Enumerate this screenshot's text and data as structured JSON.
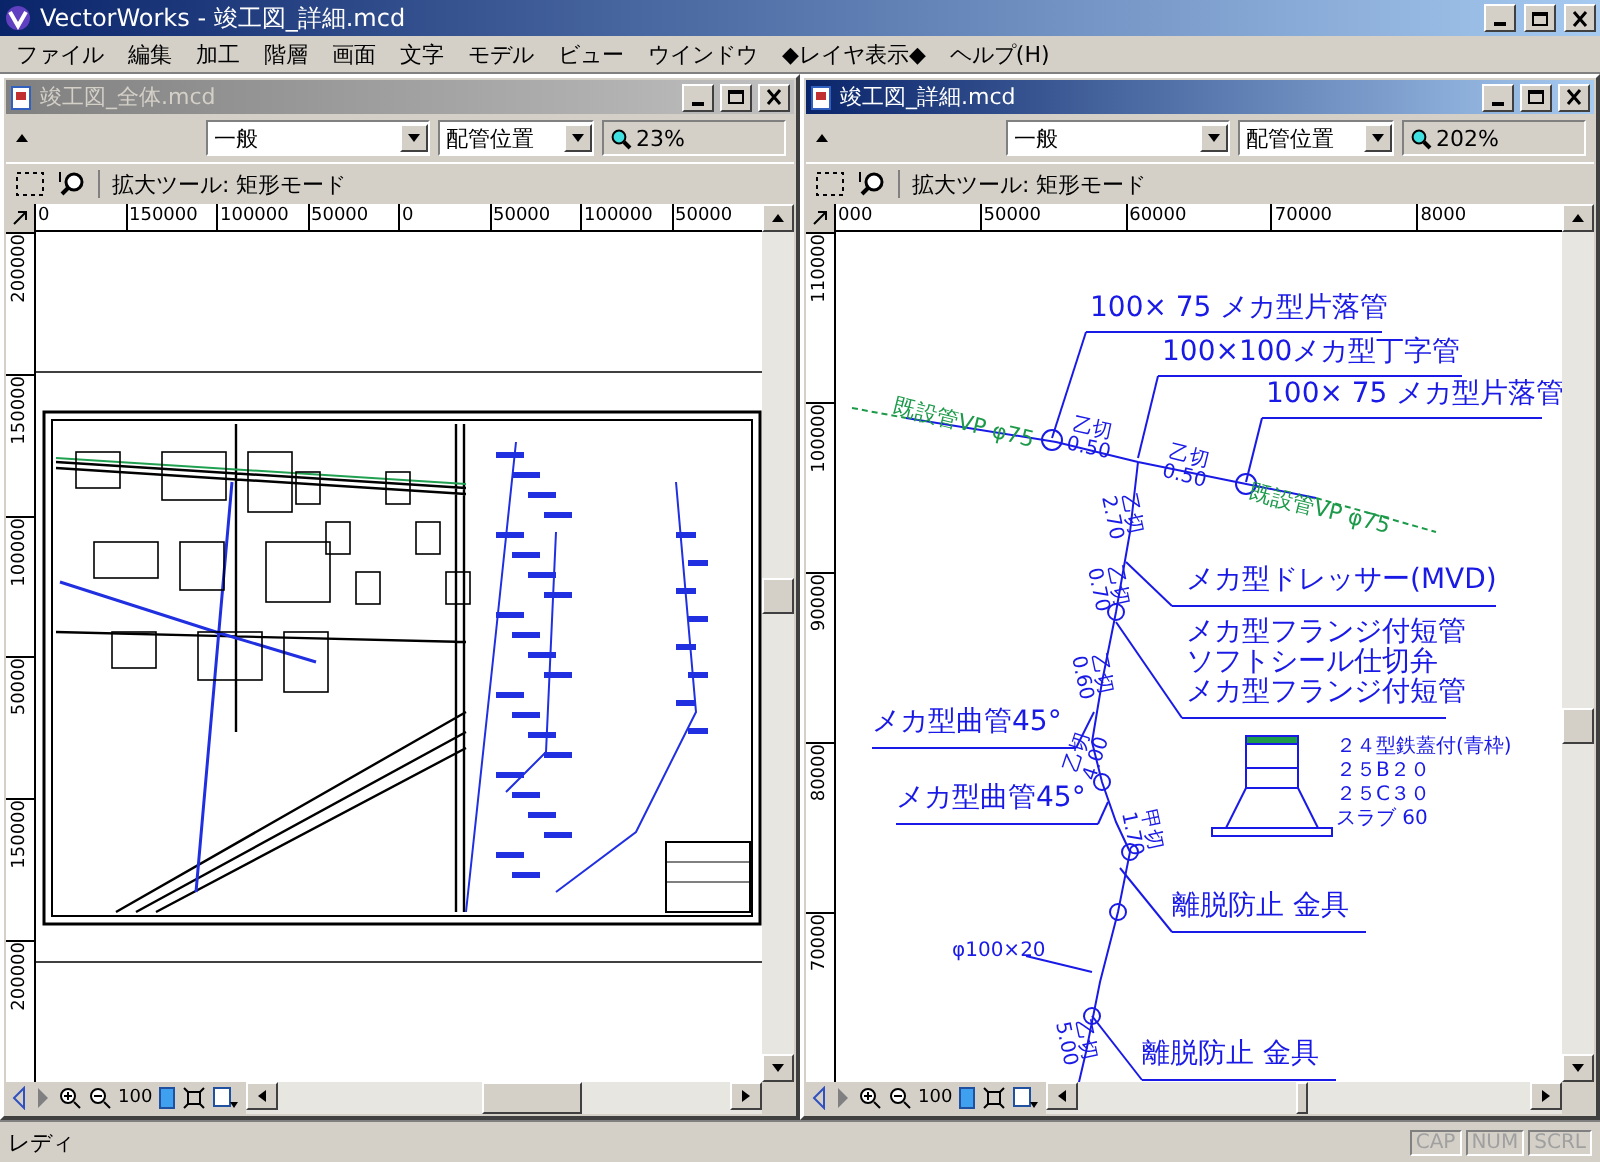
{
  "app_title": "VectorWorks - 竣工図_詳細.mcd",
  "menu": [
    "ファイル",
    "編集",
    "加工",
    "階層",
    "画面",
    "文字",
    "モデル",
    "ビュー",
    "ウインドウ",
    "◆レイヤ表示◆",
    "ヘルプ(H)"
  ],
  "windows": [
    {
      "title": "竣工図_全体.mcd",
      "active": false,
      "layer": "一般",
      "class": "配管位置",
      "zoom": "23%",
      "tool_hint": "拡大ツール: 矩形モード",
      "hruler": [
        "0",
        "150000",
        "100000",
        "50000",
        "0",
        "50000",
        "100000",
        "50000"
      ],
      "vruler": [
        "200000",
        "150000",
        "100000",
        "50000",
        "150000",
        "200000"
      ],
      "nav_scale": "100",
      "drawing": {
        "kind": "site_map"
      }
    },
    {
      "title": "竣工図_詳細.mcd",
      "active": true,
      "layer": "一般",
      "class": "配管位置",
      "zoom": "202%",
      "tool_hint": "拡大ツール: 矩形モード",
      "hruler": [
        "000",
        "50000",
        "60000",
        "70000",
        "8000"
      ],
      "vruler": [
        "110000",
        "100000",
        "90000",
        "80000",
        "70000"
      ],
      "nav_scale": "100",
      "drawing": {
        "kind": "pipe_detail",
        "callouts": [
          {
            "lines": [
              "100× 75 メカ型片落管"
            ]
          },
          {
            "lines": [
              "100×100メカ型丁字管"
            ]
          },
          {
            "lines": [
              "100× 75 メカ型片落管"
            ]
          },
          {
            "lines": [
              "メカ型ドレッサー(MVD)"
            ]
          },
          {
            "lines": [
              "メカ型フランジ付短管",
              "ソフトシール仕切弁",
              "メカ型フランジ付短管"
            ]
          },
          {
            "lines": [
              "メカ型曲管45°"
            ]
          },
          {
            "lines": [
              "メカ型曲管45°"
            ]
          },
          {
            "lines": [
              "離脱防止 金具"
            ]
          },
          {
            "lines": [
              "離脱防止 金具"
            ]
          }
        ],
        "existing_pipe_labels": [
          "既設管VP φ75",
          "既設管VP φ75"
        ],
        "fittings": [
          {
            "cut": "乙切",
            "length": "0.50"
          },
          {
            "cut": "乙切",
            "length": "0.50"
          },
          {
            "cut": "乙切",
            "length": "2.70"
          },
          {
            "cut": "乙切",
            "length": "0.70"
          },
          {
            "cut": "乙切",
            "length": "0.60"
          },
          {
            "cut": "乙切",
            "length": "4.00"
          },
          {
            "cut": "甲切",
            "length": "1.70"
          },
          {
            "cut": "乙切",
            "length": "5.00"
          }
        ],
        "manhole_notes": [
          "２４型鉄蓋付(青枠)",
          "２５B２０",
          "２５C３０",
          "スラブ 60"
        ],
        "dimension": "φ100×20"
      }
    }
  ],
  "status_bar": {
    "text": "レディ",
    "indicators": [
      {
        "label": "CAP",
        "on": false
      },
      {
        "label": "NUM",
        "on": false
      },
      {
        "label": "SCRL",
        "on": false
      }
    ]
  }
}
